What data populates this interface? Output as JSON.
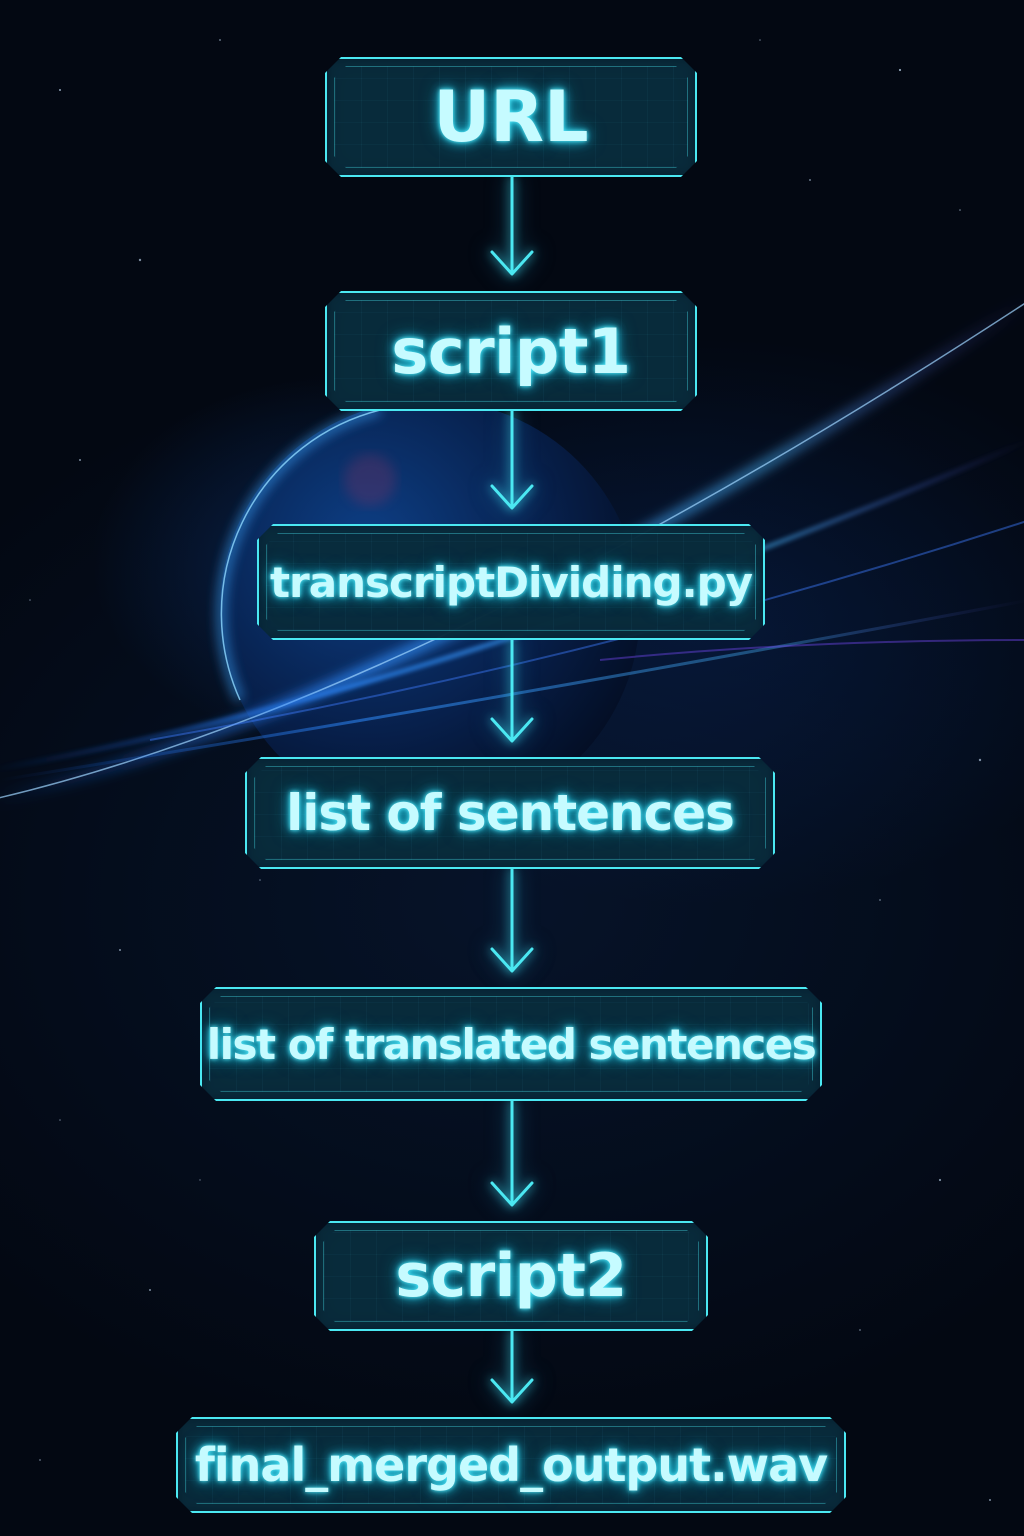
{
  "flowchart": {
    "nodes": [
      {
        "id": "url",
        "label": "URL"
      },
      {
        "id": "script1",
        "label": "script1"
      },
      {
        "id": "transcript_dividing",
        "label": "transcriptDividing.py"
      },
      {
        "id": "list_of_sentences",
        "label": "list of sentences"
      },
      {
        "id": "list_of_translated_sentences",
        "label": "list of translated sentences"
      },
      {
        "id": "script2",
        "label": "script2"
      },
      {
        "id": "final_output",
        "label": "final_merged_output.wav"
      }
    ],
    "edges": [
      {
        "from": "url",
        "to": "script1"
      },
      {
        "from": "script1",
        "to": "transcript_dividing"
      },
      {
        "from": "transcript_dividing",
        "to": "list_of_sentences"
      },
      {
        "from": "list_of_sentences",
        "to": "list_of_translated_sentences"
      },
      {
        "from": "list_of_translated_sentences",
        "to": "script2"
      },
      {
        "from": "script2",
        "to": "final_output"
      }
    ]
  },
  "theme": {
    "box_border": "#4be8f2",
    "text": "#c6fbff",
    "glow": "#1cc7e6",
    "background": "#040a17"
  }
}
